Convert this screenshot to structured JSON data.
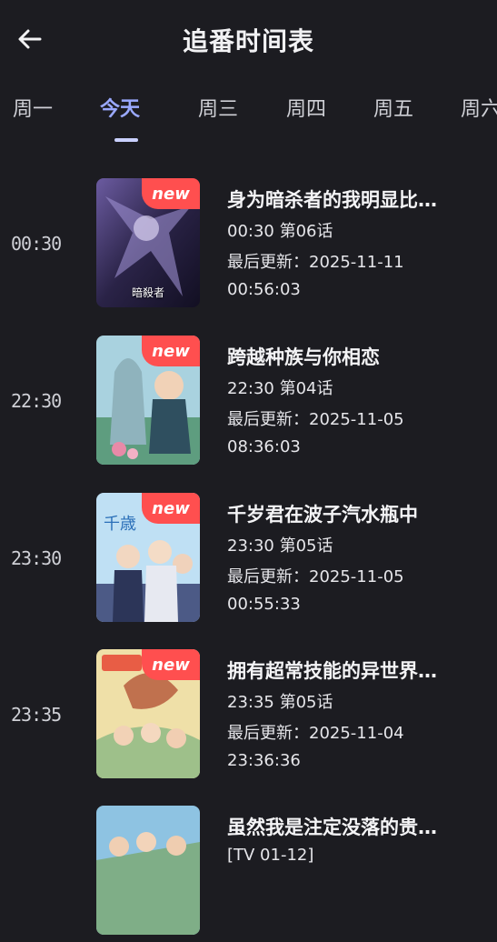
{
  "header": {
    "title": "追番时间表",
    "back_icon": "arrow-left-icon"
  },
  "tabs": [
    {
      "label": "周一",
      "active": false
    },
    {
      "label": "今天",
      "active": true
    },
    {
      "label": "周三",
      "active": false
    },
    {
      "label": "周四",
      "active": false
    },
    {
      "label": "周五",
      "active": false
    },
    {
      "label": "周六",
      "active": false
    }
  ],
  "items": [
    {
      "time": "00:30",
      "title": "身为暗杀者的我明显比…",
      "episode": "00:30 第06话",
      "updated_label": "最后更新：2025-11-11",
      "updated_time": "00:56:03",
      "badge": "new",
      "cover_colors": [
        "#3a2f5d",
        "#1b1730",
        "#7a6aa8"
      ],
      "cover_caption": "暗殺者"
    },
    {
      "time": "22:30",
      "title": "跨越种族与你相恋",
      "episode": "22:30 第04话",
      "updated_label": "最后更新：2025-11-05",
      "updated_time": "08:36:03",
      "badge": "new",
      "cover_colors": [
        "#7fb8c8",
        "#bcd9e0",
        "#4c8a73"
      ],
      "cover_caption": ""
    },
    {
      "time": "23:30",
      "title": "千岁君在波子汽水瓶中",
      "episode": "23:30 第05话",
      "updated_label": "最后更新：2025-11-05",
      "updated_time": "00:55:33",
      "badge": "new",
      "cover_colors": [
        "#79b9e8",
        "#cfe6f6",
        "#3f4f7a"
      ],
      "cover_caption": ""
    },
    {
      "time": "23:35",
      "title": "拥有超常技能的异世界…",
      "episode": "23:35 第05话",
      "updated_label": "最后更新：2025-11-04",
      "updated_time": "23:36:36",
      "badge": "new",
      "cover_colors": [
        "#e9d08a",
        "#b9d6a3",
        "#b45a43"
      ],
      "cover_caption": ""
    },
    {
      "time": "",
      "title": "虽然我是注定没落的贵…",
      "episode": "[TV 01-12]",
      "updated_label": "",
      "updated_time": "",
      "badge": "",
      "cover_colors": [
        "#6fa9cf",
        "#9cc9a0",
        "#3e6d4f"
      ],
      "cover_caption": ""
    }
  ]
}
